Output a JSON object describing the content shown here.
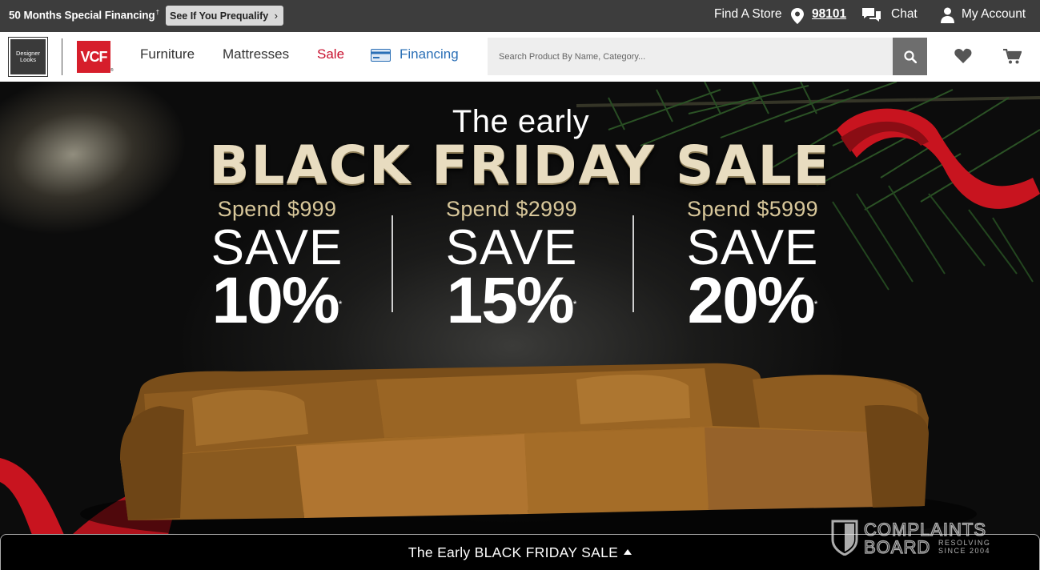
{
  "topbar": {
    "financing_text": "50 Months Special Financing",
    "financing_mark": "†",
    "prequalify_label": "See If You Prequalify",
    "find_store_label": "Find A Store",
    "zip_code": "98101",
    "chat_label": "Chat",
    "account_label": "My Account"
  },
  "header": {
    "designer_looks_line1": "Designer",
    "designer_looks_line2": "Looks",
    "vcf_logo": "VCF",
    "nav": {
      "furniture": "Furniture",
      "mattresses": "Mattresses",
      "sale": "Sale",
      "financing": "Financing"
    },
    "search_placeholder": "Search Product By Name, Category...",
    "colors": {
      "sale": "#c8102e",
      "financing": "#2a6fb6",
      "brand_red": "#d61e2b"
    }
  },
  "hero": {
    "eyebrow": "The early",
    "headline": "BLACK FRIDAY SALE",
    "tiers": [
      {
        "spend": "Spend $999",
        "save": "SAVE",
        "percent": "10%",
        "mark": "*"
      },
      {
        "spend": "Spend $2999",
        "save": "SAVE",
        "percent": "15%",
        "mark": "*"
      },
      {
        "spend": "Spend $5999",
        "save": "SAVE",
        "percent": "20%",
        "mark": "*"
      }
    ]
  },
  "promo_bar": {
    "label": "The Early BLACK FRIDAY SALE"
  },
  "watermark": {
    "line1": "COMPLAINTS",
    "line2": "BOARD",
    "tagline1": "RESOLVING",
    "tagline2": "SINCE 2004"
  }
}
